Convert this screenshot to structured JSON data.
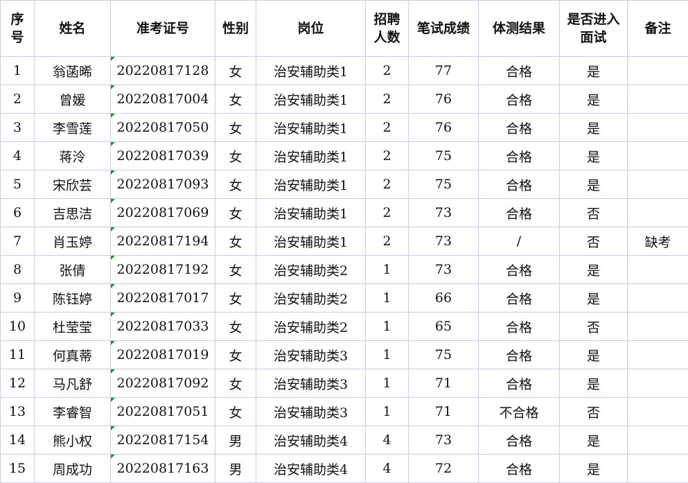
{
  "headers": {
    "seq": "序号",
    "name": "姓名",
    "ticket": "准考证号",
    "gender": "性别",
    "position": "岗位",
    "quota": "招聘人数",
    "written": "笔试成绩",
    "physical": "体测结果",
    "interview": "是否进入面试",
    "remark": "备注"
  },
  "rows": [
    {
      "seq": "1",
      "name": "翁菡晞",
      "ticket": "20220817128",
      "gender": "女",
      "position": "治安辅助类1",
      "quota": "2",
      "written": "77",
      "physical": "合格",
      "interview": "是",
      "remark": ""
    },
    {
      "seq": "2",
      "name": "曾媛",
      "ticket": "20220817004",
      "gender": "女",
      "position": "治安辅助类1",
      "quota": "2",
      "written": "76",
      "physical": "合格",
      "interview": "是",
      "remark": ""
    },
    {
      "seq": "3",
      "name": "李雪莲",
      "ticket": "20220817050",
      "gender": "女",
      "position": "治安辅助类1",
      "quota": "2",
      "written": "76",
      "physical": "合格",
      "interview": "是",
      "remark": ""
    },
    {
      "seq": "4",
      "name": "蒋泠",
      "ticket": "20220817039",
      "gender": "女",
      "position": "治安辅助类1",
      "quota": "2",
      "written": "75",
      "physical": "合格",
      "interview": "是",
      "remark": ""
    },
    {
      "seq": "5",
      "name": "宋欣芸",
      "ticket": "20220817093",
      "gender": "女",
      "position": "治安辅助类1",
      "quota": "2",
      "written": "75",
      "physical": "合格",
      "interview": "是",
      "remark": ""
    },
    {
      "seq": "6",
      "name": "吉思洁",
      "ticket": "20220817069",
      "gender": "女",
      "position": "治安辅助类1",
      "quota": "2",
      "written": "73",
      "physical": "合格",
      "interview": "否",
      "remark": ""
    },
    {
      "seq": "7",
      "name": "肖玉婷",
      "ticket": "20220817194",
      "gender": "女",
      "position": "治安辅助类1",
      "quota": "2",
      "written": "73",
      "physical": "/",
      "interview": "否",
      "remark": "缺考"
    },
    {
      "seq": "8",
      "name": "张倩",
      "ticket": "20220817192",
      "gender": "女",
      "position": "治安辅助类2",
      "quota": "1",
      "written": "73",
      "physical": "合格",
      "interview": "是",
      "remark": ""
    },
    {
      "seq": "9",
      "name": "陈钰婷",
      "ticket": "20220817017",
      "gender": "女",
      "position": "治安辅助类2",
      "quota": "1",
      "written": "66",
      "physical": "合格",
      "interview": "是",
      "remark": ""
    },
    {
      "seq": "10",
      "name": "杜莹莹",
      "ticket": "20220817033",
      "gender": "女",
      "position": "治安辅助类2",
      "quota": "1",
      "written": "65",
      "physical": "合格",
      "interview": "否",
      "remark": ""
    },
    {
      "seq": "11",
      "name": "何真蒂",
      "ticket": "20220817019",
      "gender": "女",
      "position": "治安辅助类3",
      "quota": "1",
      "written": "75",
      "physical": "合格",
      "interview": "是",
      "remark": ""
    },
    {
      "seq": "12",
      "name": "马凡舒",
      "ticket": "20220817092",
      "gender": "女",
      "position": "治安辅助类3",
      "quota": "1",
      "written": "71",
      "physical": "合格",
      "interview": "是",
      "remark": ""
    },
    {
      "seq": "13",
      "name": "李睿智",
      "ticket": "20220817051",
      "gender": "女",
      "position": "治安辅助类3",
      "quota": "1",
      "written": "71",
      "physical": "不合格",
      "interview": "否",
      "remark": ""
    },
    {
      "seq": "14",
      "name": "熊小权",
      "ticket": "20220817154",
      "gender": "男",
      "position": "治安辅助类4",
      "quota": "4",
      "written": "73",
      "physical": "合格",
      "interview": "是",
      "remark": ""
    },
    {
      "seq": "15",
      "name": "周成功",
      "ticket": "20220817163",
      "gender": "男",
      "position": "治安辅助类4",
      "quota": "4",
      "written": "72",
      "physical": "合格",
      "interview": "是",
      "remark": ""
    }
  ]
}
